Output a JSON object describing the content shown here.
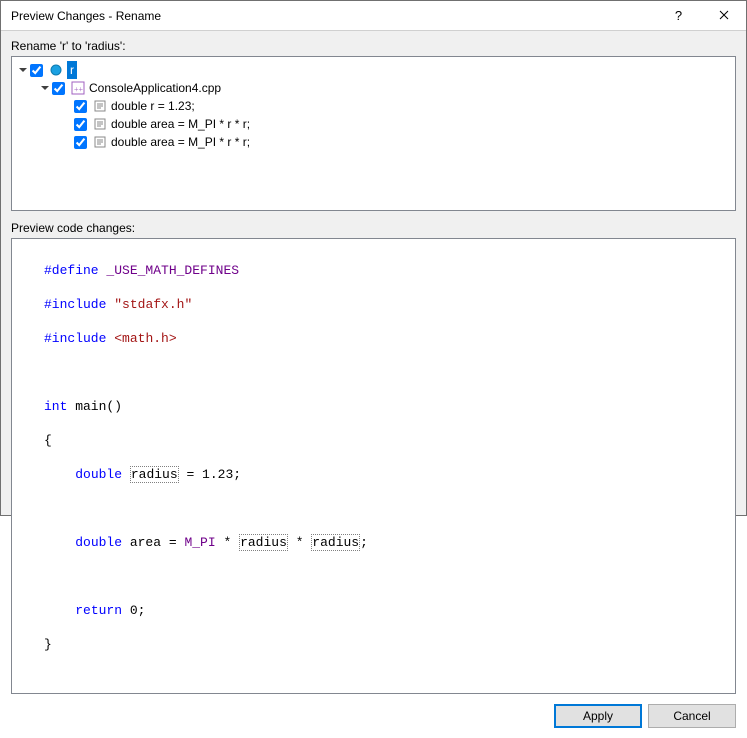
{
  "window": {
    "title": "Preview Changes - Rename"
  },
  "header": {
    "rename_label": "Rename 'r' to 'radius':"
  },
  "tree": {
    "root": {
      "label": "r"
    },
    "file": {
      "label": "ConsoleApplication4.cpp"
    },
    "refs": [
      {
        "label": "double r = 1.23;"
      },
      {
        "label": "double area = M_PI * r * r;"
      },
      {
        "label": "double area = M_PI * r * r;"
      }
    ]
  },
  "preview": {
    "label": "Preview code changes:"
  },
  "code": {
    "define_kw": "#define",
    "define_sym": "_USE_MATH_DEFINES",
    "include_kw": "#include",
    "inc1": "\"stdafx.h\"",
    "inc2": "<math.h>",
    "int_kw": "int",
    "main_name": " main()",
    "lbrace": "{",
    "double_kw": "double",
    "radius_name": "radius",
    "eq_val": " = 1.23;",
    "area_name": " area = ",
    "mpi": "M_PI",
    "times": " * ",
    "semi": ";",
    "return_kw": "return",
    "zero": " 0;",
    "rbrace": "}"
  },
  "buttons": {
    "apply": "Apply",
    "cancel": "Cancel"
  }
}
